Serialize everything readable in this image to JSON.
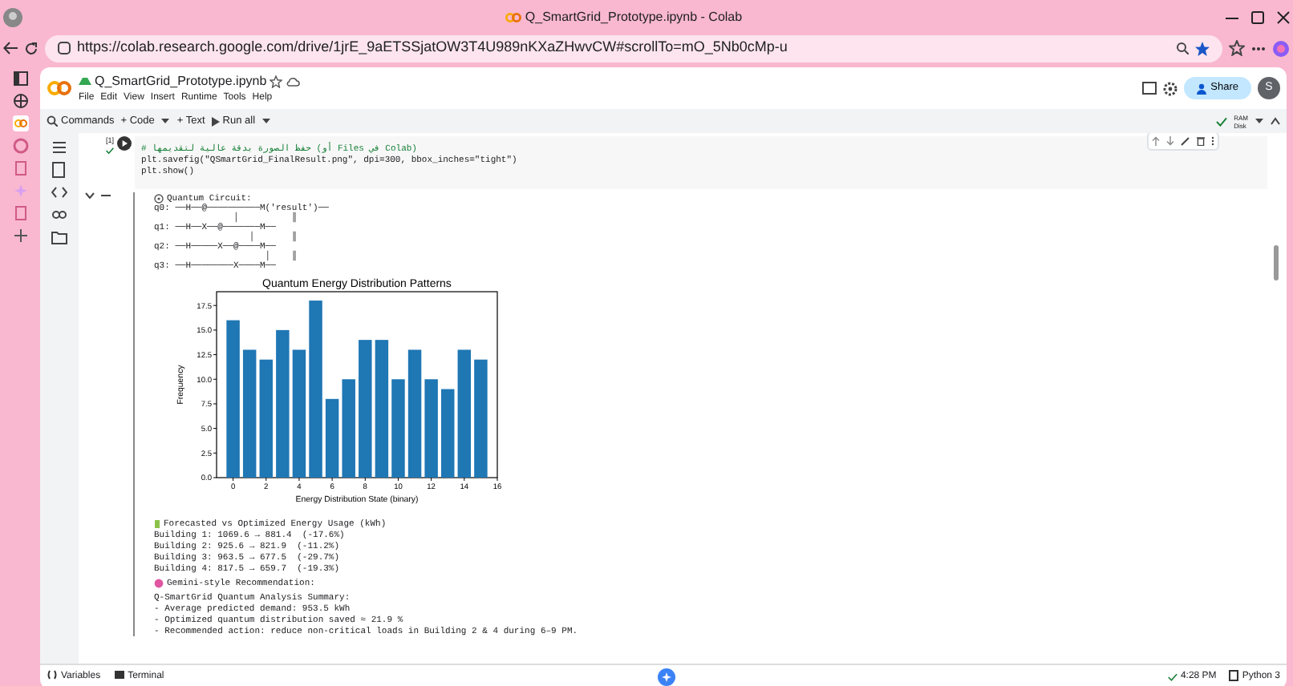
{
  "browser": {
    "title": "Q_SmartGrid_Prototype.ipynb - Colab",
    "url": "https://colab.research.google.com/drive/1jrE_9aETSSjatOW3T4U989nKXaZHwvCW#scrollTo=mO_5Nb0cMp-u"
  },
  "notebook": {
    "filename": "Q_SmartGrid_Prototype.ipynb",
    "menu": [
      "File",
      "Edit",
      "View",
      "Insert",
      "Runtime",
      "Tools",
      "Help"
    ],
    "share": "Share",
    "avatar": "S"
  },
  "toolbar": {
    "items": [
      "Commands",
      "+ Code",
      "+ Text",
      "Run all"
    ],
    "ram": "RAM",
    "disk": "Disk"
  },
  "code_cell": {
    "exec_label": "[1]",
    "lines": [
      "# حفظ الصورة بدقة عالية لتقديمها (أو Files في Colab)",
      "plt.savefig(\"QSmartGrid_FinalResult.png\", dpi=300, bbox_inches=\"tight\")",
      "plt.show()"
    ]
  },
  "output": {
    "circuit_title": "Quantum Circuit:",
    "circuit_lines": [
      "q0: ──H──@──────────M('result')──",
      "               │          ║",
      "q1: ──H──X──@───────M──",
      "                  │       ║",
      "q2: ──H─────X──@────M──",
      "                     │    ║",
      "q3: ──H────────X────M──"
    ],
    "chart_data": {
      "type": "bar",
      "title": "Quantum Energy Distribution Patterns",
      "xlabel": "Energy Distribution State (binary)",
      "ylabel": "Frequency",
      "x": [
        0,
        1,
        2,
        3,
        4,
        5,
        6,
        7,
        8,
        9,
        10,
        11,
        12,
        13,
        14,
        15
      ],
      "series": [
        {
          "color": "#1f77b4",
          "values": [
            16,
            13,
            12,
            15,
            13,
            18,
            8,
            10,
            14,
            14,
            10,
            13,
            10,
            9,
            13,
            12
          ]
        }
      ],
      "xlim": [
        -1,
        16
      ],
      "ylim": [
        0,
        18.9
      ],
      "xticks": [
        0,
        2,
        4,
        6,
        8,
        10,
        12,
        14,
        16
      ],
      "yticks": [
        {
          "value": 0,
          "label": "0.0"
        },
        2.5,
        {
          "value": 5,
          "label": "5.0"
        },
        7.5,
        {
          "value": 10,
          "label": "10.0"
        },
        12.5,
        {
          "value": 15,
          "label": "15.0"
        },
        17.5
      ]
    },
    "forecast_title": "Forecasted vs Optimized Energy Usage (kWh)",
    "forecast_lines": [
      "Building 1: 1069.6 → 881.4  (-17.6%)",
      "Building 2: 925.6 → 821.9  (-11.2%)",
      "Building 3: 963.5 → 677.5  (-29.7%)",
      "Building 4: 817.5 → 659.7  (-19.3%)"
    ],
    "recommendation_title": "Gemini-style Recommendation:",
    "summary_lines": [
      "Q-SmartGrid Quantum Analysis Summary:",
      "- Average predicted demand: 953.5 kWh",
      "- Optimized quantum distribution saved ≈ 21.9 %",
      "- Recommended action: reduce non-critical loads in Building 2 & 4 during 6–9 PM."
    ]
  },
  "status_bar": {
    "variables": "Variables",
    "terminal": "Terminal",
    "time": "4:28 PM",
    "kernel": "Python 3"
  }
}
